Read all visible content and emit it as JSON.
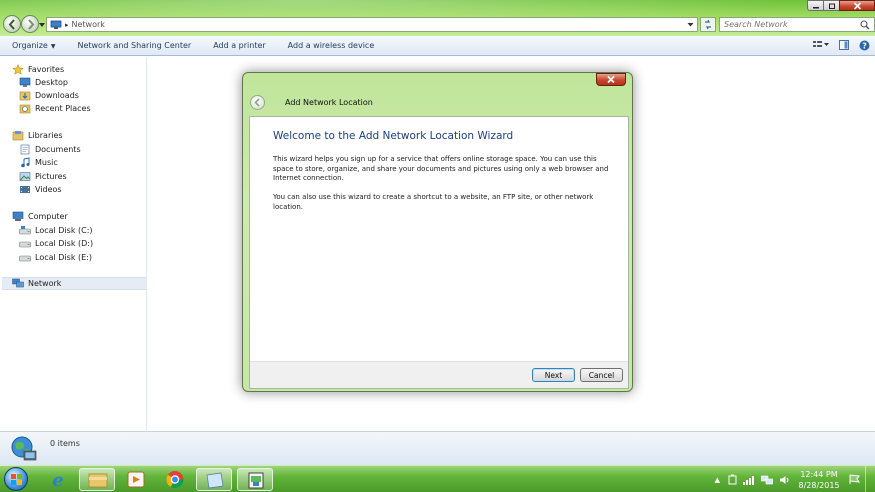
{
  "address": {
    "location": "Network"
  },
  "search": {
    "placeholder": "Search Network"
  },
  "toolbar": {
    "organize": "Organize",
    "network_sharing": "Network and Sharing Center",
    "add_printer": "Add a printer",
    "add_wireless": "Add a wireless device"
  },
  "sidebar": {
    "favorites": "Favorites",
    "desktop": "Desktop",
    "downloads": "Downloads",
    "recent_places": "Recent Places",
    "libraries": "Libraries",
    "documents": "Documents",
    "music": "Music",
    "pictures": "Pictures",
    "videos": "Videos",
    "computer": "Computer",
    "disk_c": "Local Disk (C:)",
    "disk_d": "Local Disk (D:)",
    "disk_e": "Local Disk (E:)",
    "network": "Network"
  },
  "status": {
    "items": "0 items"
  },
  "wizard": {
    "title": "Add Network Location",
    "heading": "Welcome to the Add Network Location Wizard",
    "para1": "This wizard helps you sign up for a service that offers online storage space.  You can use this space to store, organize, and share your documents and pictures using only a web browser and Internet connection.",
    "para2": "You can also use this wizard to create a shortcut to a website, an FTP site, or other network location.",
    "next": "Next",
    "cancel": "Cancel"
  },
  "taskbar": {
    "time": "12:44 PM",
    "date": "8/28/2015"
  },
  "colors": {
    "accent_green": "#62b43a",
    "heading_blue": "#1a3f86",
    "close_red": "#c9462c"
  }
}
